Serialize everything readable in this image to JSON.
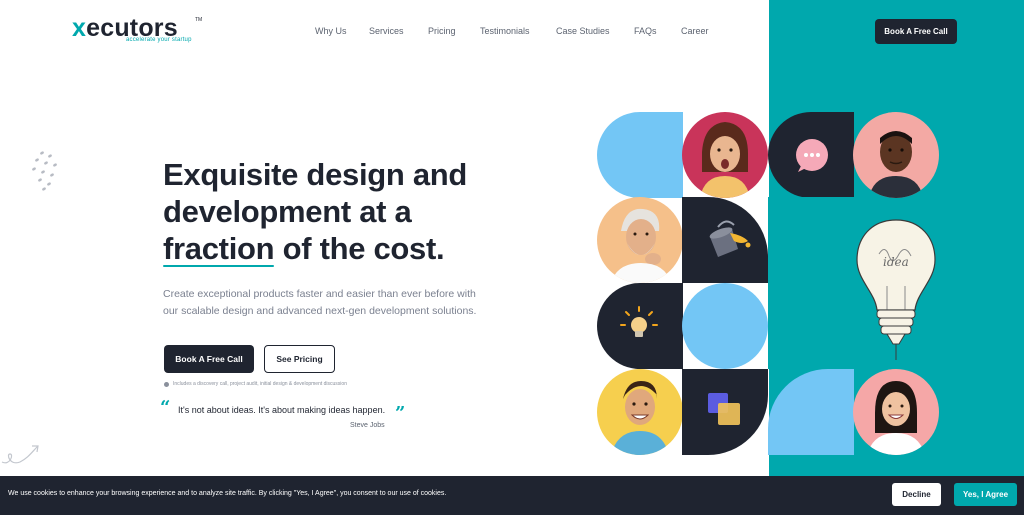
{
  "brand": {
    "logo_x": "x",
    "logo_rest": "ecutors",
    "logo_tm": "TM",
    "tagline": "accelerate your startup",
    "accent_color": "#00a8ad",
    "dark_color": "#1f2430"
  },
  "nav": {
    "items": [
      {
        "label": "Why Us"
      },
      {
        "label": "Services"
      },
      {
        "label": "Pricing"
      },
      {
        "label": "Testimonials"
      },
      {
        "label": "Case Studies"
      },
      {
        "label": "FAQs"
      },
      {
        "label": "Career"
      }
    ],
    "cta_label": "Book A Free Call"
  },
  "hero": {
    "title_line1": "Exquisite design and",
    "title_line2": "development at a",
    "title_highlight": "fraction",
    "title_line3_rest": " of the cost.",
    "subtitle": "Create exceptional products faster and easier than ever before with our scalable design and advanced next-gen development solutions.",
    "primary_cta": "Book A Free Call",
    "secondary_cta": "See Pricing",
    "note": "Includes a discovery call, project audit, initial design & development discussion",
    "quote": "It's not about ideas. It's about making ideas happen.",
    "quote_author": "Steve Jobs",
    "quote_open": "“",
    "quote_close": "”"
  },
  "grid": {
    "icons": [
      "chat-bubble-icon",
      "paint-bucket-icon",
      "lightbulb-icon",
      "layers-icon",
      "idea-bulb-illustration"
    ],
    "photos": [
      "woman-surprised-photo",
      "man-smiling-photo",
      "older-man-thinking-photo",
      "young-man-smiling-photo",
      "woman-smiling-photo"
    ],
    "bulb_text": "idea"
  },
  "cookie": {
    "text": "We use cookies to enhance your browsing experience and to analyze site traffic. By clicking \"Yes, I Agree\", you consent to our use of cookies.",
    "decline_label": "Decline",
    "agree_label": "Yes, I Agree"
  }
}
